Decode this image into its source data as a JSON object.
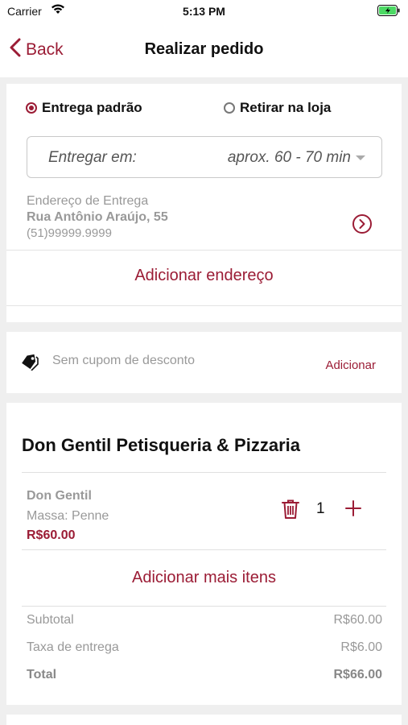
{
  "status_bar": {
    "carrier": "Carrier",
    "time": "5:13 PM"
  },
  "nav": {
    "back_label": "Back",
    "title": "Realizar pedido"
  },
  "delivery": {
    "option_standard": "Entrega padrão",
    "option_pickup": "Retirar na loja",
    "selected": "standard",
    "deliver_label": "Entregar em:",
    "deliver_value": "aprox. 60 - 70 min",
    "address_title": "Endereço de Entrega",
    "address_street": "Rua Antônio Araújo, 55",
    "address_phone": "(51)99999.9999",
    "add_address": "Adicionar endereço"
  },
  "coupon": {
    "text": "Sem cupom de desconto",
    "add": "Adicionar"
  },
  "order": {
    "store_name": "Don Gentil Petisqueria & Pizzaria",
    "items": [
      {
        "name": "Don Gentil",
        "option": "Massa: Penne",
        "price": "R$60.00",
        "quantity": "1"
      }
    ],
    "add_more": "Adicionar mais itens",
    "subtotal_label": "Subtotal",
    "subtotal_value": "R$60.00",
    "fee_label": "Taxa de entrega",
    "fee_value": "R$6.00",
    "total_label": "Total",
    "total_value": "R$66.00"
  },
  "colors": {
    "accent": "#9b1c35",
    "background": "#efefef",
    "muted_text": "#999999",
    "battery_green": "#4cd964"
  }
}
